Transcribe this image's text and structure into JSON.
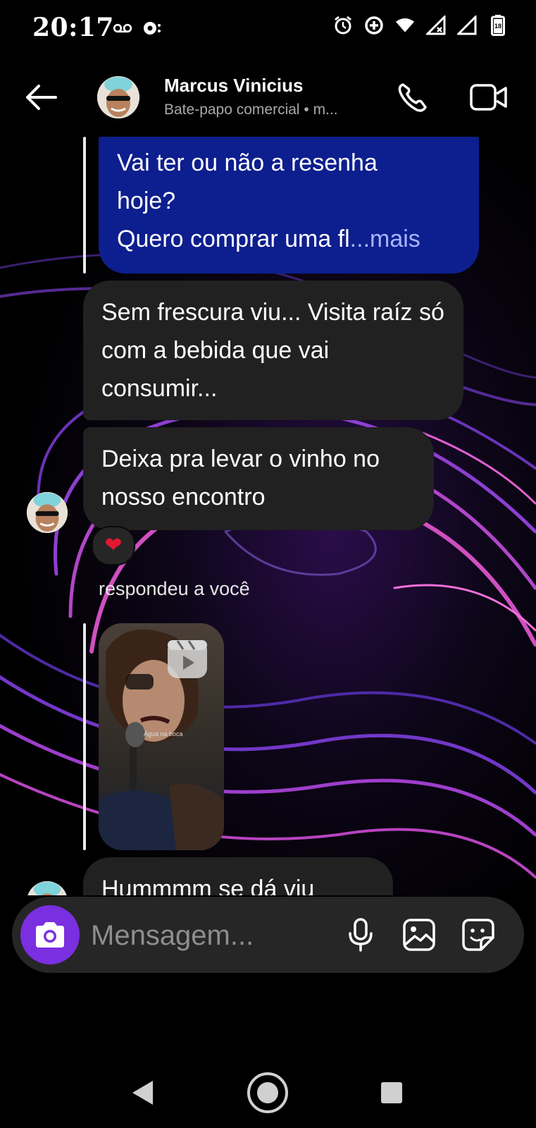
{
  "status_bar": {
    "time": "20:17",
    "battery_level": "18",
    "icons": [
      "voicemail-icon",
      "notification-icon",
      "alarm-icon",
      "data-saver-icon",
      "wifi-icon",
      "signal-no-service-icon",
      "signal-icon",
      "battery-icon"
    ]
  },
  "header": {
    "contact_name": "Marcus Vinicius",
    "subtitle": "Bate-papo comercial • m..."
  },
  "messages": {
    "outgoing_1": {
      "line1": "Vai ter ou não a resenha",
      "line2": "hoje?",
      "line3_prefix": "Quero comprar uma fl",
      "more_label": "...mais"
    },
    "incoming_1": "Sem frescura viu... Visita raíz só com a bebida que vai consumir...",
    "incoming_2": "Deixa pra levar o vinho no nosso encontro",
    "reaction": "❤",
    "replied_label": "respondeu a você",
    "reel_caption": "Água na boca",
    "incoming_3": "Hummmm se dá viu"
  },
  "composer": {
    "placeholder": "Mensagem..."
  },
  "colors": {
    "outgoing_bubble": "#0d1e8e",
    "incoming_bubble": "#212121",
    "camera_button": "#7a2fe0",
    "reaction_heart": "#e0192f"
  }
}
